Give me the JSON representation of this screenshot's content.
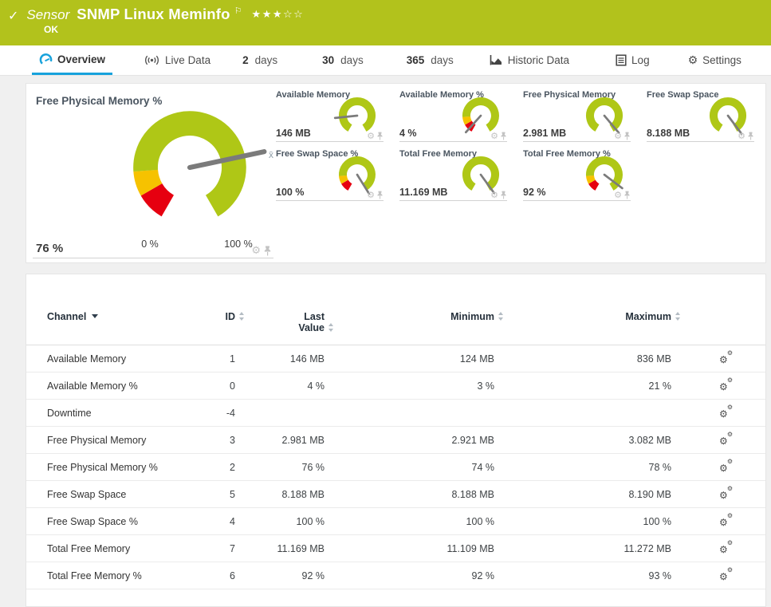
{
  "header": {
    "kind_label": "Sensor",
    "sensor_name": "SNMP Linux Meminfo",
    "status": "OK",
    "stars_filled": "★★★",
    "stars_empty": "☆☆"
  },
  "icons": {
    "check": "✓",
    "flag": "⚐",
    "gear": "⚙"
  },
  "colors": {
    "status_ok_green": "#b2c21c",
    "gauge_green": "#afc716",
    "gauge_yellow": "#f6c200",
    "gauge_red": "#e60010",
    "active_tab_blue": "#17a2dc"
  },
  "tabs": {
    "overview": {
      "label": "Overview"
    },
    "live_data": {
      "label": "Live Data"
    },
    "days2": {
      "num": "2",
      "unit": "days"
    },
    "days30": {
      "num": "30",
      "unit": "days"
    },
    "days365": {
      "num": "365",
      "unit": "days"
    },
    "historic": {
      "label": "Historic Data"
    },
    "log": {
      "label": "Log"
    },
    "settings": {
      "label": "Settings"
    }
  },
  "gauges": {
    "main": {
      "label": "Free Physical Memory %",
      "value": "76 %",
      "scale_min": "0 %",
      "scale_max": "100 %",
      "avg_marker": "x̄",
      "needle_deg": 78,
      "segments": [
        {
          "color": "#e60010",
          "from": 210,
          "to": 240
        },
        {
          "color": "#f6c200",
          "from": 240,
          "to": 266
        },
        {
          "color": "#afc716",
          "from": 266,
          "to": 510
        }
      ]
    },
    "small": [
      {
        "label": "Available Memory",
        "value": "146 MB",
        "needle_deg": 264,
        "segments": [
          {
            "color": "#afc716",
            "from": 210,
            "to": 510
          }
        ]
      },
      {
        "label": "Available Memory %",
        "value": "4 %",
        "needle_deg": 222,
        "segments": [
          {
            "color": "#e60010",
            "from": 210,
            "to": 240
          },
          {
            "color": "#f6c200",
            "from": 240,
            "to": 266
          },
          {
            "color": "#afc716",
            "from": 266,
            "to": 510
          }
        ]
      },
      {
        "label": "Free Physical Memory",
        "value": "2.981 MB",
        "needle_deg": 140,
        "segments": [
          {
            "color": "#afc716",
            "from": 210,
            "to": 510
          }
        ]
      },
      {
        "label": "Free Swap Space",
        "value": "8.188 MB",
        "needle_deg": 143,
        "segments": [
          {
            "color": "#afc716",
            "from": 210,
            "to": 510
          }
        ]
      },
      {
        "label": "Free Swap Space %",
        "value": "100 %",
        "needle_deg": 148,
        "segments": [
          {
            "color": "#e60010",
            "from": 210,
            "to": 240
          },
          {
            "color": "#f6c200",
            "from": 240,
            "to": 266
          },
          {
            "color": "#afc716",
            "from": 266,
            "to": 510
          }
        ]
      },
      {
        "label": "Total Free Memory",
        "value": "11.169 MB",
        "needle_deg": 144,
        "segments": [
          {
            "color": "#afc716",
            "from": 210,
            "to": 510
          }
        ]
      },
      {
        "label": "Total Free Memory %",
        "value": "92 %",
        "needle_deg": 127,
        "segments": [
          {
            "color": "#e60010",
            "from": 210,
            "to": 240
          },
          {
            "color": "#f6c200",
            "from": 240,
            "to": 266
          },
          {
            "color": "#afc716",
            "from": 266,
            "to": 510
          }
        ]
      }
    ]
  },
  "table": {
    "columns": {
      "channel": "Channel",
      "id": "ID",
      "last": "Last Value",
      "min": "Minimum",
      "max": "Maximum"
    },
    "rows": [
      {
        "channel": "Available Memory",
        "id": "1",
        "last": "146 MB",
        "min": "124 MB",
        "max": "836 MB"
      },
      {
        "channel": "Available Memory %",
        "id": "0",
        "last": "4 %",
        "min": "3 %",
        "max": "21 %"
      },
      {
        "channel": "Downtime",
        "id": "-4",
        "last": "",
        "min": "",
        "max": ""
      },
      {
        "channel": "Free Physical Memory",
        "id": "3",
        "last": "2.981 MB",
        "min": "2.921 MB",
        "max": "3.082 MB"
      },
      {
        "channel": "Free Physical Memory %",
        "id": "2",
        "last": "76 %",
        "min": "74 %",
        "max": "78 %"
      },
      {
        "channel": "Free Swap Space",
        "id": "5",
        "last": "8.188 MB",
        "min": "8.188 MB",
        "max": "8.190 MB"
      },
      {
        "channel": "Free Swap Space %",
        "id": "4",
        "last": "100 %",
        "min": "100 %",
        "max": "100 %"
      },
      {
        "channel": "Total Free Memory",
        "id": "7",
        "last": "11.169 MB",
        "min": "11.109 MB",
        "max": "11.272 MB"
      },
      {
        "channel": "Total Free Memory %",
        "id": "6",
        "last": "92 %",
        "min": "92 %",
        "max": "93 %"
      }
    ]
  }
}
